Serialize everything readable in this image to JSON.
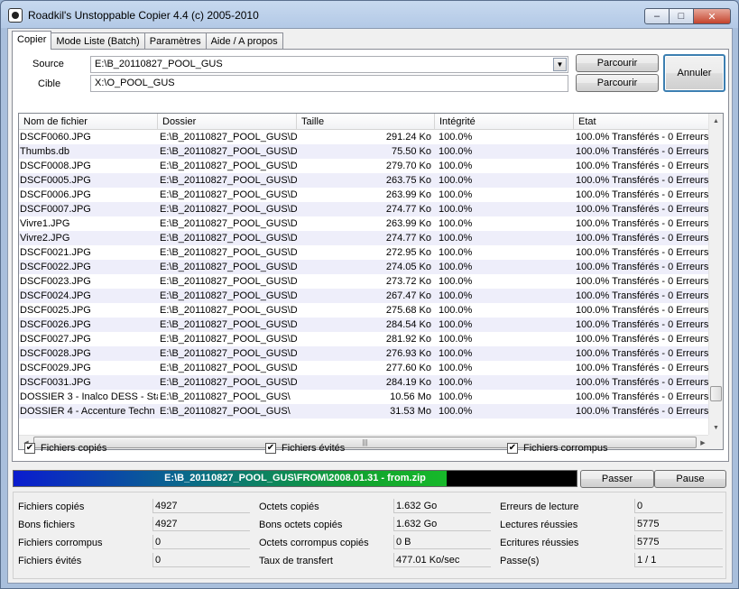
{
  "window": {
    "title": "Roadkil's Unstoppable Copier 4.4 (c) 2005-2010",
    "min": "–",
    "max": "□",
    "close": "✕"
  },
  "tabs": [
    {
      "label": "Copier"
    },
    {
      "label": "Mode Liste (Batch)"
    },
    {
      "label": "Paramètres"
    },
    {
      "label": "Aide / A propos"
    }
  ],
  "copier": {
    "source_label": "Source",
    "source_value": "E:\\B_20110827_POOL_GUS",
    "target_label": "Cible",
    "target_value": "X:\\O_POOL_GUS",
    "browse1": "Parcourir",
    "browse2": "Parcourir",
    "cancel": "Annuler"
  },
  "table": {
    "columns": [
      "Nom de fichier",
      "Dossier",
      "Taille",
      "Intégrité",
      "Etat"
    ],
    "rows": [
      [
        "DSCF0060.JPG",
        "E:\\B_20110827_POOL_GUS\\D",
        "291.24 Ko",
        "100.0%",
        "100.0% Transférés - 0 Erreurs"
      ],
      [
        "Thumbs.db",
        "E:\\B_20110827_POOL_GUS\\D",
        "75.50 Ko",
        "100.0%",
        "100.0% Transférés - 0 Erreurs"
      ],
      [
        "DSCF0008.JPG",
        "E:\\B_20110827_POOL_GUS\\D",
        "279.70 Ko",
        "100.0%",
        "100.0% Transférés - 0 Erreurs"
      ],
      [
        "DSCF0005.JPG",
        "E:\\B_20110827_POOL_GUS\\D",
        "263.75 Ko",
        "100.0%",
        "100.0% Transférés - 0 Erreurs"
      ],
      [
        "DSCF0006.JPG",
        "E:\\B_20110827_POOL_GUS\\D",
        "263.99 Ko",
        "100.0%",
        "100.0% Transférés - 0 Erreurs"
      ],
      [
        "DSCF0007.JPG",
        "E:\\B_20110827_POOL_GUS\\D",
        "274.77 Ko",
        "100.0%",
        "100.0% Transférés - 0 Erreurs"
      ],
      [
        "Vivre1.JPG",
        "E:\\B_20110827_POOL_GUS\\D",
        "263.99 Ko",
        "100.0%",
        "100.0% Transférés - 0 Erreurs"
      ],
      [
        "Vivre2.JPG",
        "E:\\B_20110827_POOL_GUS\\D",
        "274.77 Ko",
        "100.0%",
        "100.0% Transférés - 0 Erreurs"
      ],
      [
        "DSCF0021.JPG",
        "E:\\B_20110827_POOL_GUS\\D",
        "272.95 Ko",
        "100.0%",
        "100.0% Transférés - 0 Erreurs"
      ],
      [
        "DSCF0022.JPG",
        "E:\\B_20110827_POOL_GUS\\D",
        "274.05 Ko",
        "100.0%",
        "100.0% Transférés - 0 Erreurs"
      ],
      [
        "DSCF0023.JPG",
        "E:\\B_20110827_POOL_GUS\\D",
        "273.72 Ko",
        "100.0%",
        "100.0% Transférés - 0 Erreurs"
      ],
      [
        "DSCF0024.JPG",
        "E:\\B_20110827_POOL_GUS\\D",
        "267.47 Ko",
        "100.0%",
        "100.0% Transférés - 0 Erreurs"
      ],
      [
        "DSCF0025.JPG",
        "E:\\B_20110827_POOL_GUS\\D",
        "275.68 Ko",
        "100.0%",
        "100.0% Transférés - 0 Erreurs"
      ],
      [
        "DSCF0026.JPG",
        "E:\\B_20110827_POOL_GUS\\D",
        "284.54 Ko",
        "100.0%",
        "100.0% Transférés - 0 Erreurs"
      ],
      [
        "DSCF0027.JPG",
        "E:\\B_20110827_POOL_GUS\\D",
        "281.92 Ko",
        "100.0%",
        "100.0% Transférés - 0 Erreurs"
      ],
      [
        "DSCF0028.JPG",
        "E:\\B_20110827_POOL_GUS\\D",
        "276.93 Ko",
        "100.0%",
        "100.0% Transférés - 0 Erreurs"
      ],
      [
        "DSCF0029.JPG",
        "E:\\B_20110827_POOL_GUS\\D",
        "277.60 Ko",
        "100.0%",
        "100.0% Transférés - 0 Erreurs"
      ],
      [
        "DSCF0031.JPG",
        "E:\\B_20110827_POOL_GUS\\D",
        "284.19 Ko",
        "100.0%",
        "100.0% Transférés - 0 Erreurs"
      ],
      [
        "DOSSIER 3 - Inalco DESS - Sta",
        "E:\\B_20110827_POOL_GUS\\",
        "10.56 Mo",
        "100.0%",
        "100.0% Transférés - 0 Erreurs"
      ],
      [
        "DOSSIER 4 - Accenture Techn",
        "E:\\B_20110827_POOL_GUS\\",
        "31.53 Mo",
        "100.0%",
        "100.0% Transférés - 0 Erreurs"
      ]
    ]
  },
  "filters": {
    "copied": "Fichiers copiés",
    "skipped": "Fichiers évités",
    "corrupt": "Fichiers corrompus",
    "check": "✔"
  },
  "progress": {
    "text": "E:\\B_20110827_POOL_GUS\\FROM\\2008.01.31 - from.zip",
    "fraction": 0.77,
    "skip": "Passer",
    "pause": "Pause"
  },
  "stats": {
    "files_copied_label": "Fichiers copiés",
    "files_copied": "4927",
    "good_files_label": "Bons fichiers",
    "good_files": "4927",
    "corrupt_files_label": "Fichiers corrompus",
    "corrupt_files": "0",
    "skipped_files_label": "Fichiers évités",
    "skipped_files": "0",
    "bytes_copied_label": "Octets copiés",
    "bytes_copied": "1.632 Go",
    "good_bytes_label": "Bons octets copiés",
    "good_bytes": "1.632 Go",
    "corrupt_bytes_label": "Octets corrompus copiés",
    "corrupt_bytes": "0 B",
    "rate_label": "Taux de transfert",
    "rate": "477.01 Ko/sec",
    "read_errors_label": "Erreurs de lecture",
    "read_errors": "0",
    "reads_ok_label": "Lectures réussies",
    "reads_ok": "5775",
    "writes_ok_label": "Ecritures réussies",
    "writes_ok": "5775",
    "passes_label": "Passe(s)",
    "passes": "1 / 1"
  }
}
